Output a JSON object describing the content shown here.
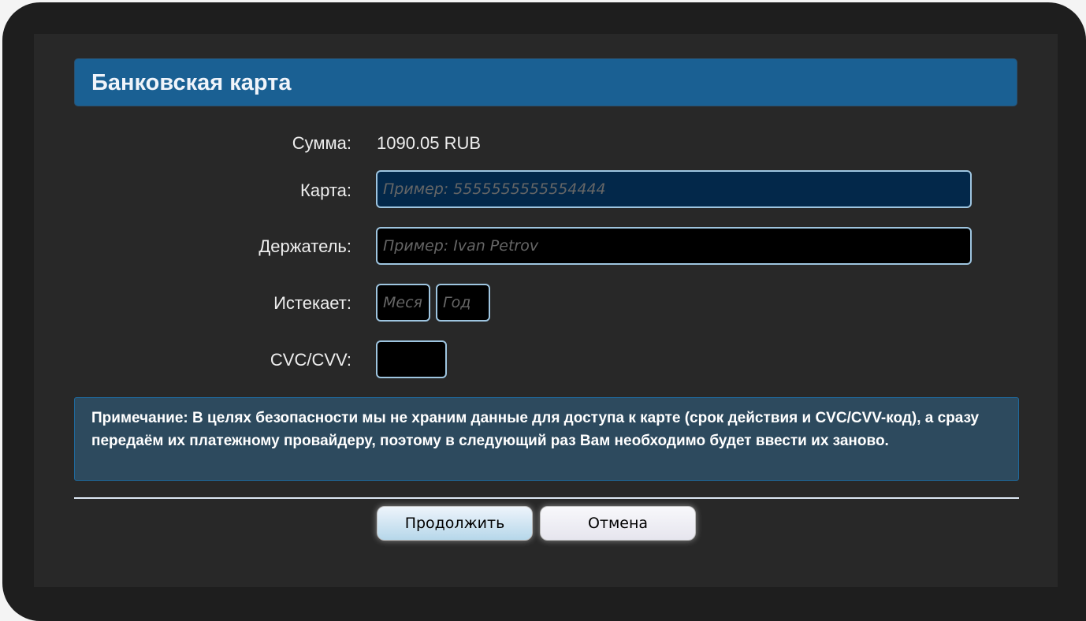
{
  "dialog": {
    "title": "Банковская карта",
    "amount_label": "Сумма:",
    "amount_value": "1090.05 RUB",
    "card_label": "Карта:",
    "card_placeholder": "Пример: 5555555555554444",
    "holder_label": "Держатель:",
    "holder_placeholder": "Пример: Ivan Petrov",
    "expires_label": "Истекает:",
    "month_placeholder": "Месяц",
    "year_placeholder": "Год",
    "cvc_label": "CVC/CVV:",
    "note": "Примечание: В целях безопасности мы не храним данные для доступа к карте (срок действия и CVC/CVV-код), а сразу передаём их платежному провайдеру, поэтому в следующий раз Вам необходимо будет ввести их заново.",
    "continue_label": "Продолжить",
    "cancel_label": "Отмена"
  }
}
